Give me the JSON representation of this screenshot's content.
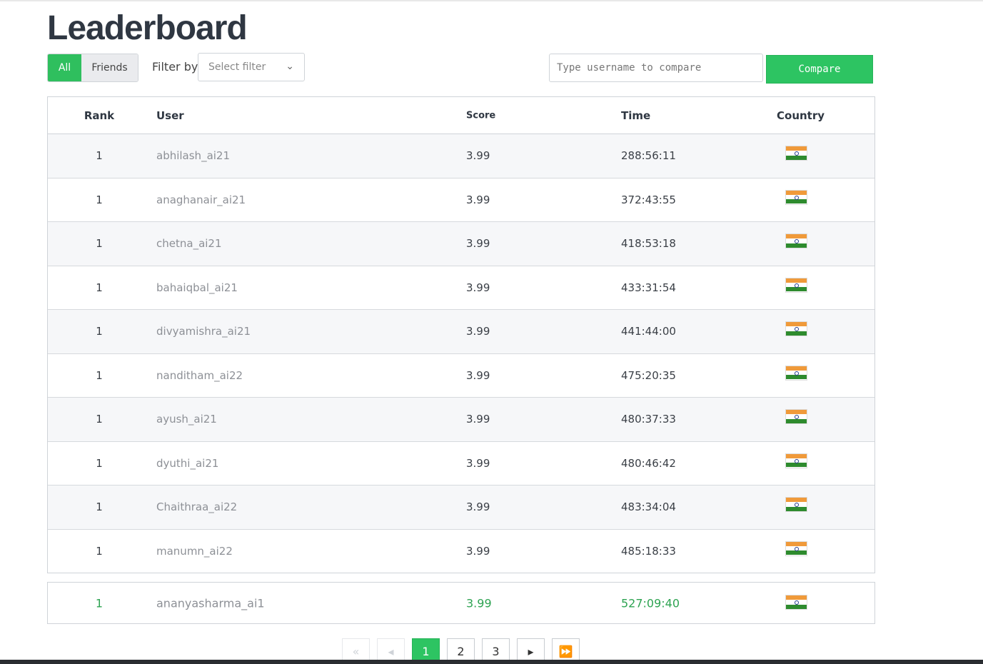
{
  "page": {
    "title": "Leaderboard"
  },
  "toggle": {
    "all_label": "All",
    "friends_label": "Friends",
    "active": "All"
  },
  "filter": {
    "label": "Filter by",
    "placeholder": "Select filter"
  },
  "compare": {
    "placeholder": "Type username to compare",
    "button_label": "Compare"
  },
  "table": {
    "headers": {
      "rank": "Rank",
      "user": "User",
      "score": "Score",
      "time": "Time",
      "country": "Country"
    },
    "rows": [
      {
        "rank": "1",
        "user": "abhilash_ai21",
        "score": "3.99",
        "time": "288:56:11",
        "country": "india-flag-icon"
      },
      {
        "rank": "1",
        "user": "anaghanair_ai21",
        "score": "3.99",
        "time": "372:43:55",
        "country": "india-flag-icon"
      },
      {
        "rank": "1",
        "user": "chetna_ai21",
        "score": "3.99",
        "time": "418:53:18",
        "country": "india-flag-icon"
      },
      {
        "rank": "1",
        "user": "bahaiqbal_ai21",
        "score": "3.99",
        "time": "433:31:54",
        "country": "india-flag-icon"
      },
      {
        "rank": "1",
        "user": "divyamishra_ai21",
        "score": "3.99",
        "time": "441:44:00",
        "country": "india-flag-icon"
      },
      {
        "rank": "1",
        "user": "nanditham_ai22",
        "score": "3.99",
        "time": "475:20:35",
        "country": "india-flag-icon"
      },
      {
        "rank": "1",
        "user": "ayush_ai21",
        "score": "3.99",
        "time": "480:37:33",
        "country": "india-flag-icon"
      },
      {
        "rank": "1",
        "user": "dyuthi_ai21",
        "score": "3.99",
        "time": "480:46:42",
        "country": "india-flag-icon"
      },
      {
        "rank": "1",
        "user": "Chaithraa_ai22",
        "score": "3.99",
        "time": "483:34:04",
        "country": "india-flag-icon"
      },
      {
        "rank": "1",
        "user": "manumn_ai22",
        "score": "3.99",
        "time": "485:18:33",
        "country": "india-flag-icon"
      }
    ]
  },
  "current_user": {
    "rank": "1",
    "user": "ananyasharma_ai1",
    "score": "3.99",
    "time": "527:09:40",
    "country": "india-flag-icon"
  },
  "pagination": {
    "pages": [
      "1",
      "2",
      "3"
    ],
    "current": "1",
    "first_icon": "double-chevron-left-icon",
    "prev_icon": "triangle-left-icon",
    "next_icon": "triangle-right-icon",
    "last_icon": "double-triangle-right-icon"
  },
  "colors": {
    "accent": "#2dc462",
    "highlight_text": "#2ea352"
  }
}
